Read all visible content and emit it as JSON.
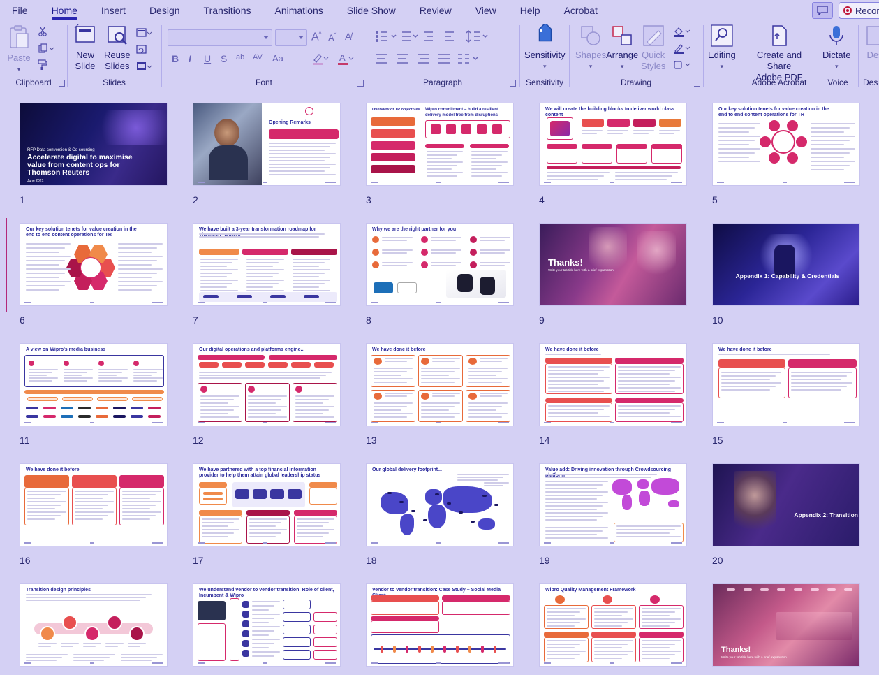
{
  "menu": {
    "tabs": [
      "File",
      "Home",
      "Insert",
      "Design",
      "Transitions",
      "Animations",
      "Slide Show",
      "Review",
      "View",
      "Help",
      "Acrobat"
    ],
    "active_tab": "Home",
    "record_label": "Record"
  },
  "ribbon": {
    "clipboard": {
      "paste": "Paste",
      "label": "Clipboard"
    },
    "slides": {
      "new_slide": "New Slide",
      "new_slide_line1": "New",
      "new_slide_line2": "Slide",
      "reuse_line1": "Reuse",
      "reuse_line2": "Slides",
      "label": "Slides"
    },
    "font": {
      "label": "Font"
    },
    "paragraph": {
      "label": "Paragraph"
    },
    "sensitivity": {
      "button": "Sensitivity",
      "label": "Sensitivity"
    },
    "drawing": {
      "shapes": "Shapes",
      "arrange": "Arrange",
      "quick_line1": "Quick",
      "quick_line2": "Styles",
      "label": "Drawing"
    },
    "editing": {
      "button": "Editing"
    },
    "acrobat": {
      "line1": "Create and Share",
      "line2": "Adobe PDF",
      "label": "Adobe Acrobat"
    },
    "voice": {
      "button": "Dictate",
      "label": "Voice"
    },
    "designer": {
      "button": "Des",
      "label": "Des"
    }
  },
  "slides": [
    {
      "num": "1",
      "title": "Accelerate digital to maximise value from content ops for Thomson Reuters",
      "kicker": "RFP Data conversion & Co-sourcing",
      "date": "June 2021",
      "style": "cover-dark"
    },
    {
      "num": "2",
      "title": "Opening Remarks",
      "style": "photo-left"
    },
    {
      "num": "3",
      "title": "Overview of TR objectives",
      "title2": "Wipro commitment – build a resilient delivery model free from disruptions",
      "style": "two-col-red"
    },
    {
      "num": "4",
      "title": "We will create the building blocks to deliver world class content",
      "style": "flow-boxes"
    },
    {
      "num": "5",
      "title": "Our key solution tenets for value creation in the end to end content operations for TR",
      "center": "Keystone",
      "style": "hub"
    },
    {
      "num": "6",
      "title": "Our key solution tenets for value creation in the end to end content operations for TR",
      "center": "Keystone",
      "style": "hub-hex"
    },
    {
      "num": "7",
      "title": "We have built a 3-year transformation roadmap for Thomson Reuters",
      "years": [
        "Year 1",
        "Year 2",
        "Year 3"
      ],
      "style": "roadmap"
    },
    {
      "num": "8",
      "title": "Why we are the right partner for you",
      "style": "partner"
    },
    {
      "num": "9",
      "title": "Thanks!",
      "subtitle": "Write your tab title here with a brief explanation",
      "style": "thanks-photo"
    },
    {
      "num": "10",
      "title": "Appendix 1: Capability & Credentials",
      "style": "appendix-dark"
    },
    {
      "num": "11",
      "title": "A view on Wipro's media business",
      "style": "media"
    },
    {
      "num": "12",
      "title": "Our digital operations and platforms engine...",
      "style": "digital-ops"
    },
    {
      "num": "13",
      "title": "We have done it before",
      "style": "grid6"
    },
    {
      "num": "14",
      "title": "We have done it before",
      "style": "two-panels"
    },
    {
      "num": "15",
      "title": "We have done it before",
      "style": "two-headers"
    },
    {
      "num": "16",
      "title": "We have done it before",
      "style": "three-cols"
    },
    {
      "num": "17",
      "title": "We have partnered with a top financial information provider to help them attain global leadership status",
      "style": "partnered"
    },
    {
      "num": "18",
      "title": "Our global delivery footprint...",
      "style": "map-blue"
    },
    {
      "num": "19",
      "title": "Value add: Driving innovation through Crowdsourcing platform",
      "style": "map-pink"
    },
    {
      "num": "20",
      "title": "Appendix 2: Transition",
      "style": "appendix-photo"
    },
    {
      "num": "21",
      "title": "Transition design principles",
      "style": "circles"
    },
    {
      "num": "22",
      "title": "We understand vendor to vendor transition: Role of client, Incumbent & Wipro",
      "style": "vendor"
    },
    {
      "num": "23",
      "title": "Vendor to vendor transition: Case Study – Social Media Client",
      "style": "case-study"
    },
    {
      "num": "24",
      "title": "Wipro Quality Management Framework",
      "style": "quality"
    },
    {
      "num": "25",
      "title": "Thanks!",
      "subtitle": "Write your tab title here with a brief explanation",
      "style": "thanks-office"
    }
  ],
  "colors": {
    "background": "#d4d0f4",
    "accent": "#2a26b0",
    "wipro_red": "#d5296b",
    "title_blue": "#2b2a9c"
  }
}
